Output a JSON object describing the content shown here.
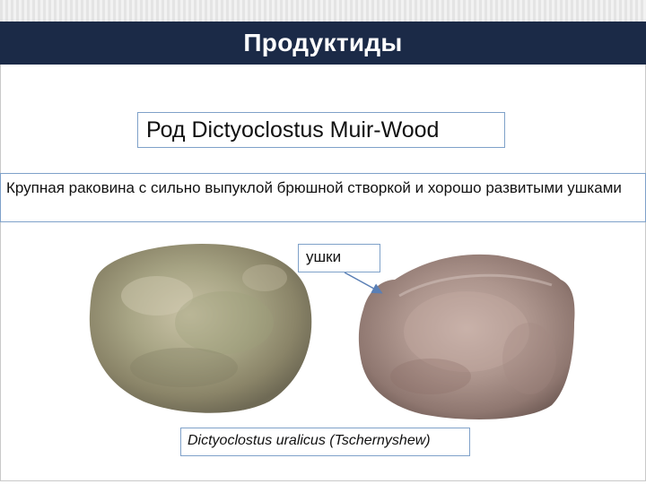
{
  "slide": {
    "title": "Продуктиды",
    "genus_label": "Род Dictyoclostus Muir-Wood",
    "description": "Крупная раковина с сильно выпуклой брюшной створкой и хорошо развитыми ушками",
    "ears_label": "ушки",
    "species_caption": "Dictyoclostus uralicus (Tschernyshew)"
  },
  "images": {
    "left_fossil": "fossil-shell-dorsal-view",
    "right_fossil": "fossil-shell-ventral-view"
  },
  "colors": {
    "title_bar": "#1b2a47",
    "box_border": "#7fa1c9",
    "arrow": "#5a7fb5"
  }
}
